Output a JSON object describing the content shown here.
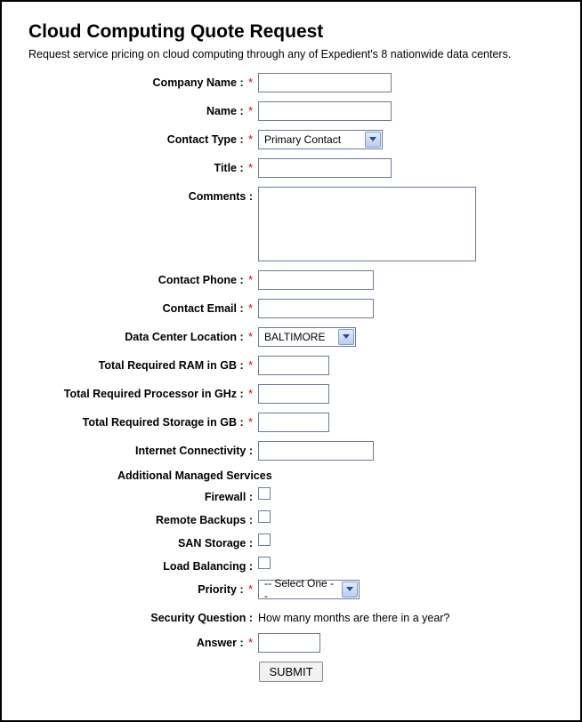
{
  "header": {
    "title": "Cloud Computing Quote Request",
    "subtitle": "Request service pricing on cloud computing through any of Expedient's 8 nationwide data centers."
  },
  "labels": {
    "company_name": "Company Name :",
    "name": "Name :",
    "contact_type": "Contact Type :",
    "title": "Title :",
    "comments": "Comments :",
    "contact_phone": "Contact Phone :",
    "contact_email": "Contact Email :",
    "data_center": "Data Center Location :",
    "ram": "Total Required RAM in GB :",
    "processor": "Total Required Processor in GHz :",
    "storage": "Total Required Storage in GB :",
    "internet": "Internet Connectivity :",
    "managed_header": "Additional Managed Services",
    "firewall": "Firewall :",
    "remote_backups": "Remote Backups :",
    "san_storage": "SAN Storage :",
    "load_balancing": "Load Balancing :",
    "priority": "Priority :",
    "security_q": "Security Question :",
    "answer": "Answer :",
    "req_marker": "*"
  },
  "values": {
    "company_name": "",
    "name": "",
    "contact_type": "Primary Contact",
    "title": "",
    "comments": "",
    "contact_phone": "",
    "contact_email": "",
    "data_center": "BALTIMORE",
    "ram": "",
    "processor": "",
    "storage": "",
    "internet": "",
    "priority": "-- Select One --",
    "security_q_text": "How many months are there in a year?",
    "answer": ""
  },
  "submit_label": "SUBMIT"
}
